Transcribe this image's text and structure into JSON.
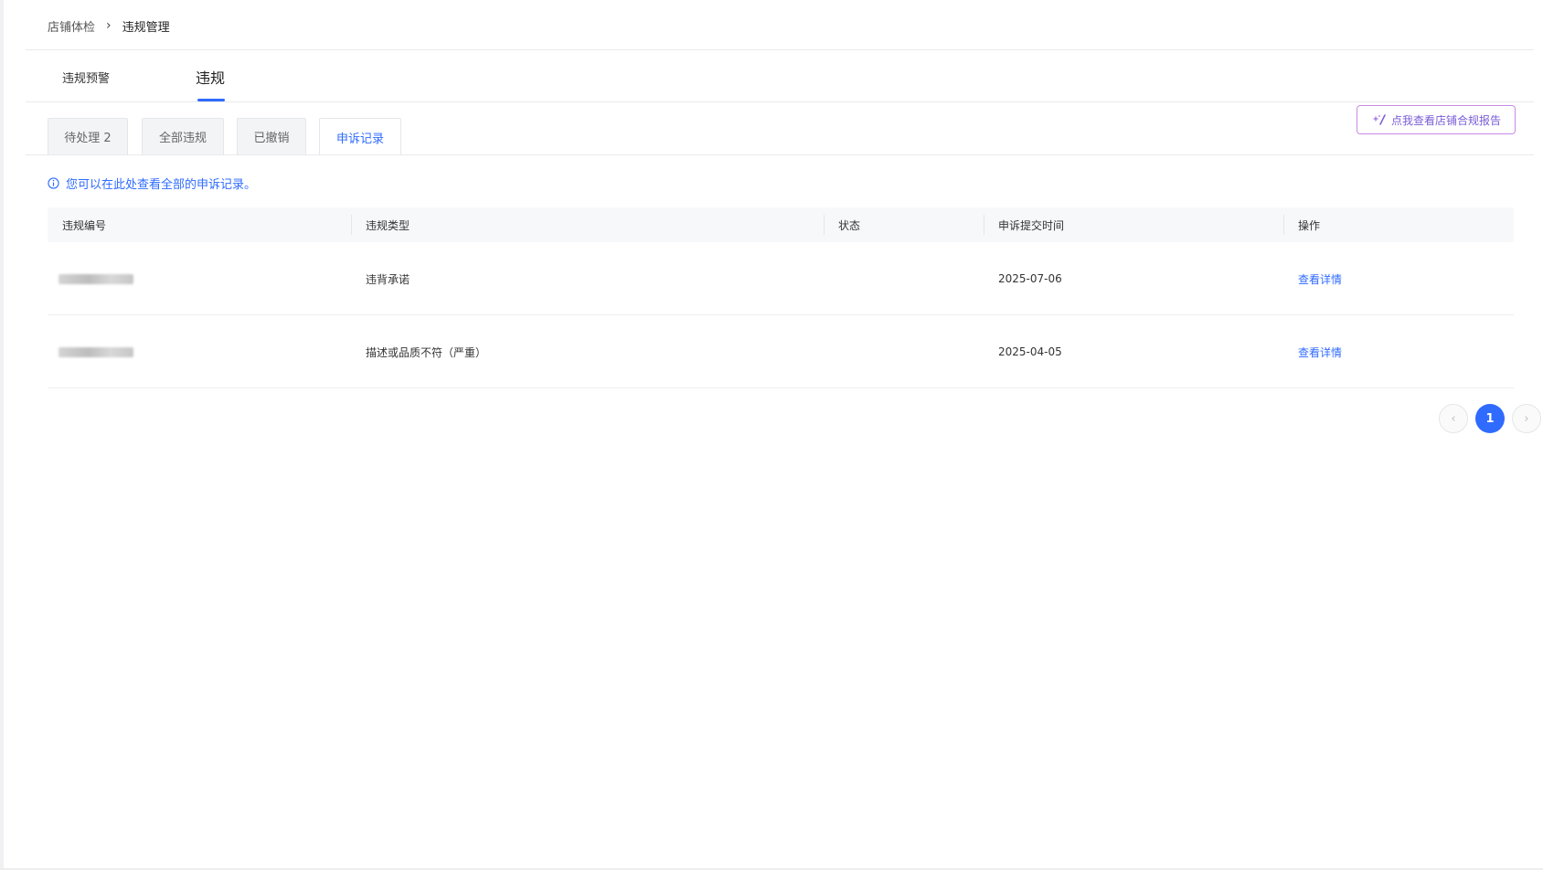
{
  "breadcrumb": {
    "items": [
      "店铺体检",
      "违规管理"
    ],
    "separator": "›"
  },
  "primary_tabs": {
    "items": [
      "违规预警",
      "违规"
    ],
    "active": "违规"
  },
  "sub_tabs": {
    "items": [
      "待处理 2",
      "全部违规",
      "已撤销",
      "申诉记录"
    ],
    "active": "申诉记录"
  },
  "report_button": {
    "label": "点我查看店铺合规报告"
  },
  "notice": {
    "text": "您可以在此处查看全部的申诉记录。"
  },
  "table": {
    "columns": [
      "违规编号",
      "违规类型",
      "状态",
      "申诉提交时间",
      "操作"
    ],
    "rows": [
      {
        "id": "",
        "type": "违背承诺",
        "status": "",
        "submitted": "2025-07-06",
        "action": "查看详情"
      },
      {
        "id": "",
        "type": "描述或品质不符（严重）",
        "status": "",
        "submitted": "2025-04-05",
        "action": "查看详情"
      }
    ]
  },
  "pagination": {
    "prev": "‹",
    "current": "1",
    "next": "›"
  },
  "colors": {
    "accent": "#2f6bff",
    "report_border": "#c98ae6",
    "report_text": "#7a5cd6"
  }
}
